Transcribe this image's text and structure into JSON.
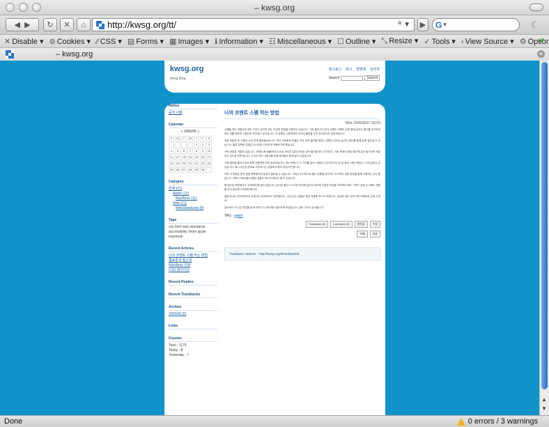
{
  "window": {
    "title": "– kwsg.org"
  },
  "navbar": {
    "url": "http://kwsg.org/tt/",
    "url_suffix": "ᴿ ▼"
  },
  "devbar": {
    "items": [
      {
        "icon": "✕",
        "label": "Disable ▾"
      },
      {
        "icon": "⊚",
        "label": "Cookies ▾"
      },
      {
        "icon": "⁄⁄",
        "label": "CSS ▾"
      },
      {
        "icon": "▤",
        "label": "Forms ▾"
      },
      {
        "icon": "▦",
        "label": "Images ▾"
      },
      {
        "icon": "ℹ",
        "label": "Information ▾"
      },
      {
        "icon": "☷",
        "label": "Miscellaneous ▾"
      },
      {
        "icon": "☐",
        "label": "Outline ▾"
      },
      {
        "icon": "⤡",
        "label": "Resize ▾"
      },
      {
        "icon": "✓",
        "label": "Tools ▾"
      },
      {
        "icon": "‹",
        "label": "View Source ▾"
      },
      {
        "icon": "⚙",
        "label": "Options ▾"
      }
    ]
  },
  "tab": {
    "title": "– kwsg.org"
  },
  "page": {
    "site_title": "kwsg.org",
    "site_sub": "kwsg blog",
    "top_links": [
      "태그로그",
      "태그",
      "방명록",
      "관리자"
    ],
    "search_label": "Search",
    "search_btn": "Submit",
    "sidebar": {
      "notice_title": "Notice",
      "notice_link": "공지 사항",
      "calendar_title": "Calendar",
      "calendar_head": "«   2006/06   »",
      "calendar_days": [
        "S",
        "M",
        "T",
        "W",
        "T",
        "F",
        "S",
        "",
        "",
        "",
        "",
        "1",
        "2",
        "3",
        "4",
        "5",
        "6",
        "7",
        "8",
        "9",
        "10",
        "11",
        "12",
        "13",
        "14",
        "15",
        "16",
        "17",
        "18",
        "19",
        "20",
        "21",
        "22",
        "23",
        "24",
        "25",
        "26",
        "27",
        "28",
        "29",
        "30",
        ""
      ],
      "category_title": "Category",
      "category_links": [
        "전체 (31)",
        "Apple (12)",
        "MacBook (11)",
        "Web (11)",
        "WebStandards (8)"
      ],
      "tags_title": "Tags",
      "tags_text": "css  html  web standards  accessibility  xhtml  apple  macbook",
      "recent_articles_title": "Recent Articles",
      "recent_articles": [
        "나의 코멘트 스팸 막는 방법",
        "웹표준과 접근성",
        "MacBook 리뷰",
        "CSS 레이아웃"
      ],
      "recent_replies_title": "Recent Replies",
      "recent_trackbacks_title": "Recent Trackbacks",
      "archive_title": "Archive",
      "archive_link": "2006/06 (5)",
      "links_title": "Links",
      "counter_title": "Counter",
      "counter_lines": [
        "Total : 1175",
        "Today : 8",
        "Yesterday : 7"
      ]
    },
    "article": {
      "title": "나의 코멘트 스팸 막는 방법",
      "date": "Web 2006/06/27 03:03",
      "paragraphs": [
        "스팸을 막는 방법으로 여러 가지가 있지만 저는 간단한 방법을 사용하고 있습니다. 기존 플러그인 방식 외에도 코멘트 입력 폼에 숨겨진 필드를 추가하여 봇이 이를 채우면 스팸으로 판단하는 방식입니다. 이 방법은 사용자에게 아무런 불편을 주지 않으면서도 효과적입니다.",
        "처음 적용한 후 스팸이 눈에 띄게 줄어들었습니다. 특히 자동화된 봇들은 모든 입력 필드를 채우는 경향이 있어서 숨겨진 필드를 통해 쉽게 걸러낼 수 있습니다. 물론 완벽한 방법은 아니지만 간단하게 적용하기에 좋습니다.",
        "구현 방법은 어렵지 않습니다. 코멘트 폼 템플릿에 CSS로 보이지 않게 처리한 입력 필드를 하나 추가하고, 서버 측에서 해당 필드에 값이 들어오면 저장하지 않도록 하면 됩니다. 스크린 리더 사용자를 위해 레이블도 함께 달아 두었습니다.",
        "스팸 필터링 플러그인과 함께 사용하면 더욱 효과적입니다. 저는 현재 이 두 가지를 같이 사용하고 있으며 지난 한 달 동안 스팸 코멘트가 거의 달리지 않았습니다. 혹시 비슷한 문제로 고민하시는 분들께 도움이 되었으면 합니다.",
        "다만 이 방법은 봇이 점점 똑똑해지면 효과가 떨어질 수 있습니다. 그래서 주기적으로 필드 이름을 바꾸거나 추가적인 검증 방법을 함께 사용하는 것이 좋습니다. 자바스크립트를 이용한 검증도 하나의 대안이 될 수 있습니다.",
        "웹 접근성 측면에서도 고려해야 할 점이 있습니다. 숨겨진 필드가 스크린 리더에 읽히지 않도록 적절한 속성을 부여해야 하며, 키보드 탐색 순서에도 영향을 주지 않도록 주의해야 합니다.",
        "결론적으로 간단하면서도 효과적인 방법이라고 생각합니다. 관심 있는 분들은 한번 적용해 보시기 바랍니다. 궁금한 점이 있으시면 코멘트로 남겨 주세요.",
        "앞으로도 더 나은 방법을 찾게 되면 다시 정리해서 올리도록 하겠습니다. 읽어 주셔서 감사합니다."
      ],
      "tag_label": "TAG",
      "tag_link": "spam",
      "buttons_row1": [
        "Trackback (0)",
        "Comment (0)",
        "관련글",
        "수정"
      ],
      "buttons_row2": [
        "삭제",
        "공유"
      ],
      "trackback_text": "Trackback Address :: http://kwsg.org/tt/trackback/5"
    }
  },
  "status": {
    "left": "Done",
    "right": "0 errors / 3 warnings"
  },
  "colors": {
    "page_bg": "#0f93c8",
    "link": "#1c5fa8"
  }
}
